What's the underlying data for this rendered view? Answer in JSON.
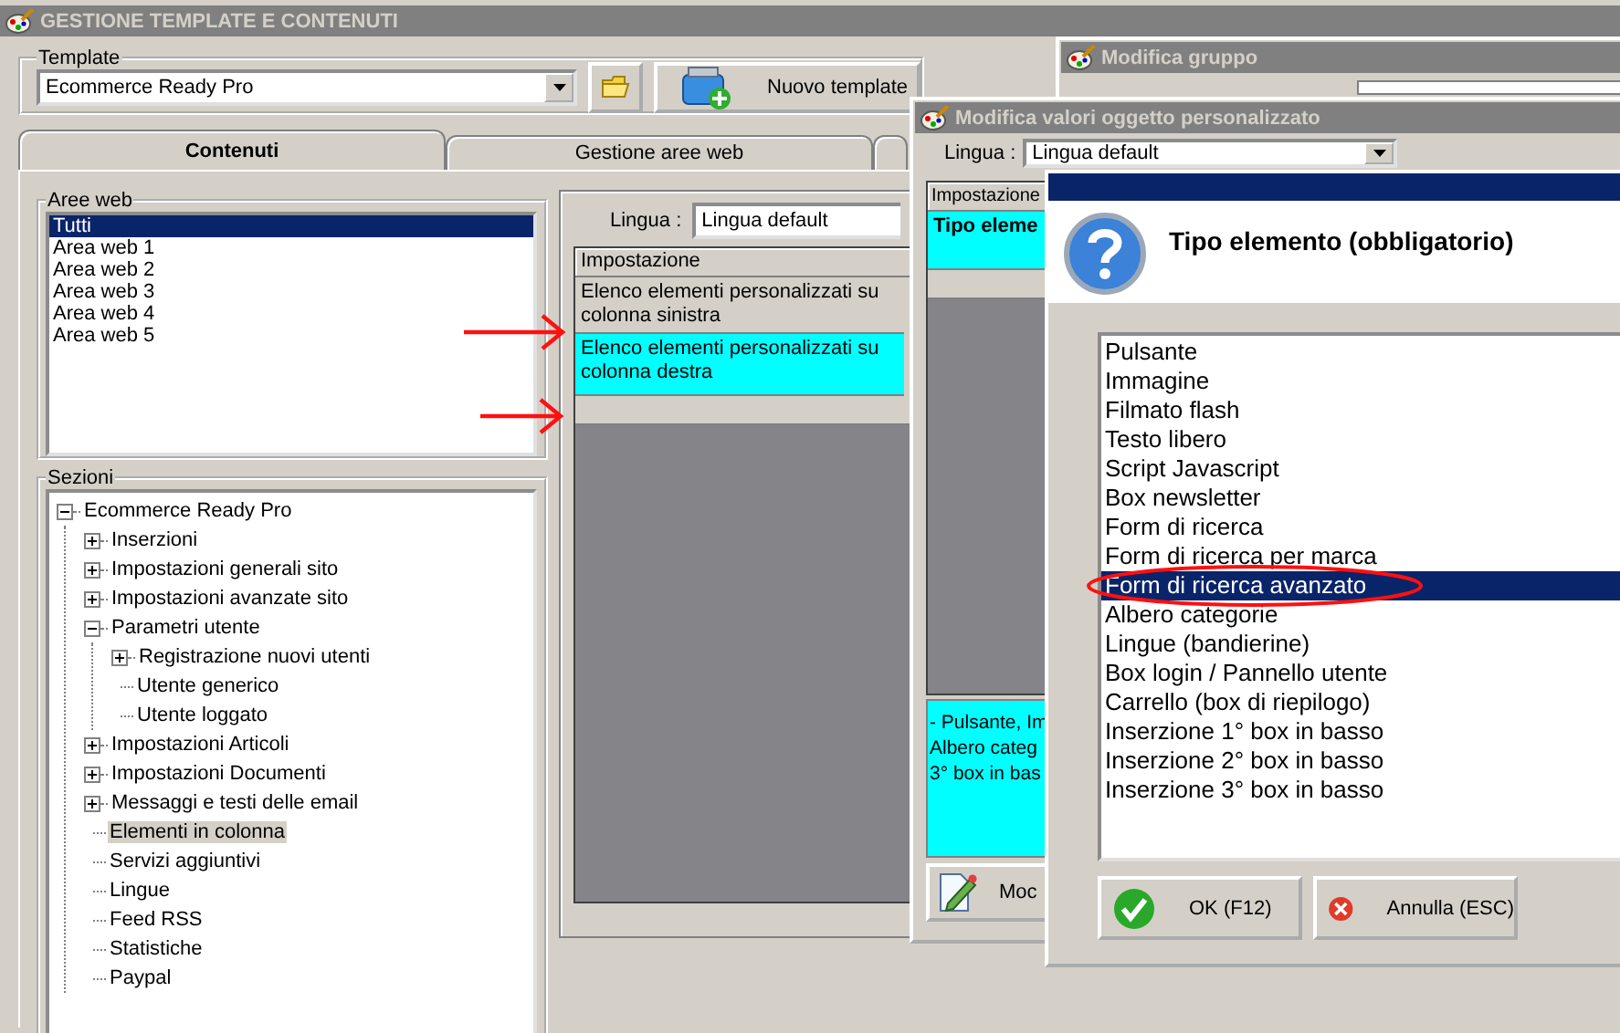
{
  "main_window": {
    "title": "GESTIONE TEMPLATE E CONTENUTI",
    "template": {
      "label": "Template",
      "value": "Ecommerce Ready Pro",
      "new_button": "Nuovo template"
    },
    "tabs": [
      {
        "label": "Contenuti",
        "selected": true
      },
      {
        "label": "Gestione aree web",
        "selected": false
      }
    ],
    "aree_web": {
      "label": "Aree web",
      "items": [
        {
          "label": "Tutti",
          "selected": true
        },
        {
          "label": "Area web 1",
          "selected": false
        },
        {
          "label": "Area web 2",
          "selected": false
        },
        {
          "label": "Area web 3",
          "selected": false
        },
        {
          "label": "Area web 4",
          "selected": false
        },
        {
          "label": "Area web 5",
          "selected": false
        }
      ]
    },
    "sezioni": {
      "label": "Sezioni",
      "tree": [
        {
          "label": "Ecommerce Ready Pro",
          "selected": false,
          "expanded": true,
          "children": [
            {
              "label": "Inserzioni",
              "selected": false,
              "expanded": false
            },
            {
              "label": "Impostazioni generali sito",
              "selected": false,
              "expanded": false
            },
            {
              "label": "Impostazioni avanzate sito",
              "selected": false,
              "expanded": false
            },
            {
              "label": "Parametri utente",
              "selected": false,
              "expanded": true,
              "children": [
                {
                  "label": "Registrazione nuovi utenti",
                  "selected": false,
                  "expanded": false
                },
                {
                  "label": "Utente generico",
                  "selected": false
                },
                {
                  "label": "Utente loggato",
                  "selected": false
                }
              ]
            },
            {
              "label": "Impostazioni Articoli",
              "selected": false,
              "expanded": false
            },
            {
              "label": "Impostazioni Documenti",
              "selected": false,
              "expanded": false
            },
            {
              "label": "Messaggi e testi delle email",
              "selected": false,
              "expanded": false
            },
            {
              "label": "Elementi in colonna",
              "selected": true
            },
            {
              "label": "Servizi aggiuntivi",
              "selected": false
            },
            {
              "label": "Lingue",
              "selected": false
            },
            {
              "label": "Feed RSS",
              "selected": false
            },
            {
              "label": "Statistiche",
              "selected": false
            },
            {
              "label": "Paypal",
              "selected": false
            }
          ]
        }
      ]
    },
    "lingua": {
      "label": "Lingua :",
      "value": "Lingua default"
    },
    "grid": {
      "header": "Impostazione",
      "rows": [
        {
          "text": "Elenco elementi personalizzati su colonna sinistra",
          "selected": false
        },
        {
          "text": "Elenco elementi personalizzati su colonna destra",
          "selected": true
        }
      ]
    }
  },
  "group_window": {
    "title": "Modifica gruppo"
  },
  "object_window": {
    "title": "Modifica valori oggetto personalizzato",
    "lingua": {
      "label": "Lingua :",
      "value": "Lingua default"
    },
    "grid": {
      "header": "Impostazione",
      "rows": [
        {
          "text": "Tipo eleme",
          "selected": true
        }
      ]
    },
    "description": [
      "- Pulsante, Im",
      "Albero categ",
      "3° box in bas"
    ],
    "edit_button": "Moc"
  },
  "dialog": {
    "title": "Tipo elemento (obbligatorio)",
    "options": [
      {
        "label": "Pulsante",
        "selected": false
      },
      {
        "label": "Immagine",
        "selected": false
      },
      {
        "label": "Filmato flash",
        "selected": false
      },
      {
        "label": "Testo libero",
        "selected": false
      },
      {
        "label": "Script Javascript",
        "selected": false
      },
      {
        "label": "Box newsletter",
        "selected": false
      },
      {
        "label": "Form di ricerca",
        "selected": false
      },
      {
        "label": "Form di ricerca per marca",
        "selected": false
      },
      {
        "label": "Form di ricerca avanzato",
        "selected": true
      },
      {
        "label": "Albero categorie",
        "selected": false
      },
      {
        "label": "Lingue (bandierine)",
        "selected": false
      },
      {
        "label": "Box login / Pannello utente",
        "selected": false
      },
      {
        "label": "Carrello (box di riepilogo)",
        "selected": false
      },
      {
        "label": "Inserzione 1° box in basso",
        "selected": false
      },
      {
        "label": "Inserzione 2° box in basso",
        "selected": false
      },
      {
        "label": "Inserzione 3° box in basso",
        "selected": false
      }
    ],
    "buttons": [
      {
        "label": "OK (F12)",
        "kind": "ok"
      },
      {
        "label": "Annulla (ESC)",
        "kind": "cancel"
      }
    ]
  }
}
